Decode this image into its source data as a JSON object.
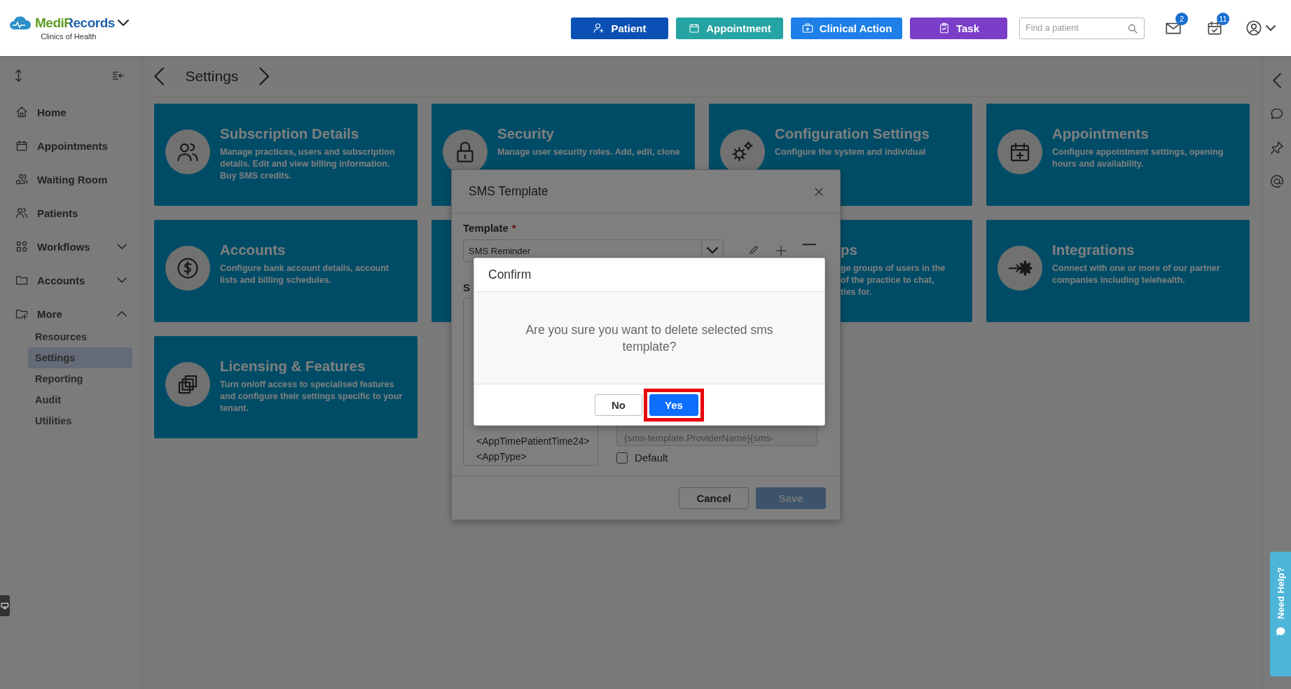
{
  "header": {
    "brand": "MediRecords",
    "subtitle": "Clinics of Health",
    "actions": [
      {
        "label": "Patient",
        "color": "#0a50b4"
      },
      {
        "label": "Appointment",
        "color": "#26a3a3"
      },
      {
        "label": "Clinical Action",
        "color": "#1f7fe8"
      },
      {
        "label": "Task",
        "color": "#7b3ec9"
      }
    ],
    "search": {
      "placeholder": "Find a patient"
    },
    "notifications": [
      {
        "kind": "mail",
        "badge": "2"
      },
      {
        "kind": "tasks",
        "badge": "11"
      }
    ]
  },
  "sidebar": {
    "items": [
      {
        "label": "Home"
      },
      {
        "label": "Appointments"
      },
      {
        "label": "Waiting Room"
      },
      {
        "label": "Patients"
      },
      {
        "label": "Workflows",
        "expanded": false
      },
      {
        "label": "Accounts",
        "expanded": false
      },
      {
        "label": "More",
        "expanded": true,
        "children": [
          {
            "label": "Resources",
            "selected": false
          },
          {
            "label": "Settings",
            "selected": true
          },
          {
            "label": "Reporting",
            "selected": false
          },
          {
            "label": "Audit",
            "selected": false
          },
          {
            "label": "Utilities",
            "selected": false
          }
        ]
      }
    ]
  },
  "page": {
    "title": "Settings"
  },
  "cards": [
    {
      "kind": "full",
      "title": "Subscription Details",
      "description": "Manage practices, users and subscription details. Edit and view billing information. Buy SMS credits."
    },
    {
      "kind": "full",
      "title": "Security",
      "description": "Manage user security roles. Add, edit, clone"
    },
    {
      "kind": "full",
      "title": "Configuration Settings",
      "description": "Configure the system and individual"
    },
    {
      "kind": "full",
      "title": "Appointments",
      "description": "Configure appointment settings, opening hours and availability."
    },
    {
      "kind": "full",
      "title": "Accounts",
      "description": "Configure bank account details, account lists and billing schedules."
    },
    {
      "kind": "covered"
    },
    {
      "kind": "partial",
      "title": "ps",
      "description": "ge groups of users in the\nof the practice to chat,\nties for."
    },
    {
      "kind": "full",
      "title": "Integrations",
      "description": "Connect with one or more of our partner companies including telehealth."
    },
    {
      "kind": "full",
      "title": "Licensing & Features",
      "description": "Turn on/off access to specialised features and configure their settings specific to your tenant."
    }
  ],
  "sms_dialog": {
    "title": "SMS Template",
    "template_label": "Template",
    "required_mark": "*",
    "template_value": "SMS Reminder",
    "section_label": "S",
    "fields_list": [
      "<AppTimePatientTime24>",
      "<AppType>"
    ],
    "message_value": "{sms-template.ProviderName}{sms-",
    "default_checkbox": {
      "label": "Default",
      "checked": false
    },
    "buttons": [
      {
        "label": "Cancel",
        "kind": "secondary"
      },
      {
        "label": "Save",
        "kind": "primary",
        "disabled": true
      }
    ]
  },
  "confirm_dialog": {
    "title": "Confirm",
    "message": "Are you sure you want to delete selected sms template?",
    "buttons": [
      {
        "label": "No",
        "kind": "secondary",
        "highlighted": false
      },
      {
        "label": "Yes",
        "kind": "primary",
        "highlighted": true
      }
    ]
  },
  "help_tab": {
    "label": "Need Help?"
  }
}
